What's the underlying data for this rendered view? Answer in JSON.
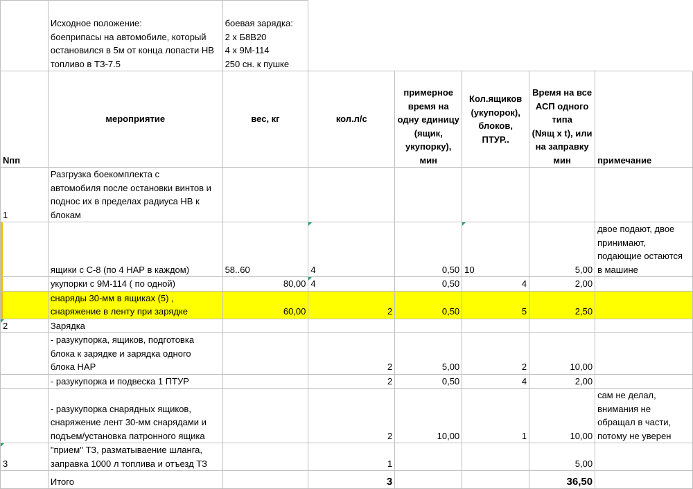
{
  "colors": {
    "highlight": "#ffff00",
    "grid": "#bfbfbf",
    "comment_marker": "#21a366"
  },
  "top": {
    "initial_state": "Исходное положение:\nбоеприпасы на автомобиле, который\nостановился в 5м от конца лопасти НВ\nтопливо в ТЗ-7.5",
    "combat_load": "боевая зарядка:\n2 х Б8В20\n4 х 9М-114\n250 сн. к пушке"
  },
  "headers": {
    "npp": "Nпп",
    "event": "мероприятие",
    "weight": "вес, кг",
    "staff": "кол.л/с",
    "time_per_unit": "примерное\nвремя на\nодну единицу\n(ящик,\nукупорку),\nмин",
    "count": "Кол.ящиков\n(укупорок),\nблоков,\nПТУР..",
    "time_total": "Время на все\nАСП одного\nтипа\n(Nящ х t), или\nна заправку\nмин",
    "note": "примечание"
  },
  "rows": [
    {
      "npp": "1",
      "event": "Разгрузка боекомплекта с\nавтомобиля после остановки винтов и\nподнос их в пределах радиуса НВ к\nблокам",
      "weight": "",
      "staff": "",
      "time": "",
      "count": "",
      "total": "",
      "note": ""
    },
    {
      "npp": "",
      "event": "ящики с С-8 (по 4 НАР в каждом)",
      "weight": "58..60",
      "staff": "4",
      "time": "0,50",
      "count": "10",
      "total": "5,00",
      "note": "двое подают, двое\nпринимают,\nподающие остаются\nв машине"
    },
    {
      "npp": "",
      "event": "укупорки с 9М-114 ( по одной)",
      "weight": "80,00",
      "staff": "4",
      "time": "0,50",
      "count": "4",
      "total": "2,00",
      "note": ""
    },
    {
      "npp": "",
      "event": "снаряды 30-мм в ящиках (5) ,\nснаряжение в ленту  при зарядке",
      "weight": "60,00",
      "staff": "2",
      "time": "0,50",
      "count": "5",
      "total": "2,50",
      "note": ""
    },
    {
      "npp": "2",
      "event": "Зарядка",
      "weight": "",
      "staff": "",
      "time": "",
      "count": "",
      "total": "",
      "note": ""
    },
    {
      "npp": "",
      "event": "- разукупорка, ящиков, подготовка\nблока к зарядке и зарядка одного\nблока НАР",
      "weight": "",
      "staff": "2",
      "time": "5,00",
      "count": "2",
      "total": "10,00",
      "note": ""
    },
    {
      "npp": "",
      "event": "- разукупорка и подвеска 1 ПТУР",
      "weight": "",
      "staff": "2",
      "time": "0,50",
      "count": "4",
      "total": "2,00",
      "note": ""
    },
    {
      "npp": "",
      "event": "- разукупорка снарядных ящиков,\nснаряжение лент 30-мм снарядами и\nподъем/установка патронного ящика",
      "weight": "",
      "staff": "2",
      "time": "10,00",
      "count": "1",
      "total": "10,00",
      "note": "сам не делал,\nвнимания не\nобращал в части,\nпотому не уверен"
    },
    {
      "npp": "3",
      "event": "\"прием\" ТЗ, разматываение шланга,\nзаправка 1000 л топлива и отъезд ТЗ",
      "weight": "",
      "staff": "1",
      "time": "",
      "count": "",
      "total": "5,00",
      "note": ""
    }
  ],
  "total": {
    "label": "Итого",
    "staff": "3",
    "time_total": "36,50"
  }
}
